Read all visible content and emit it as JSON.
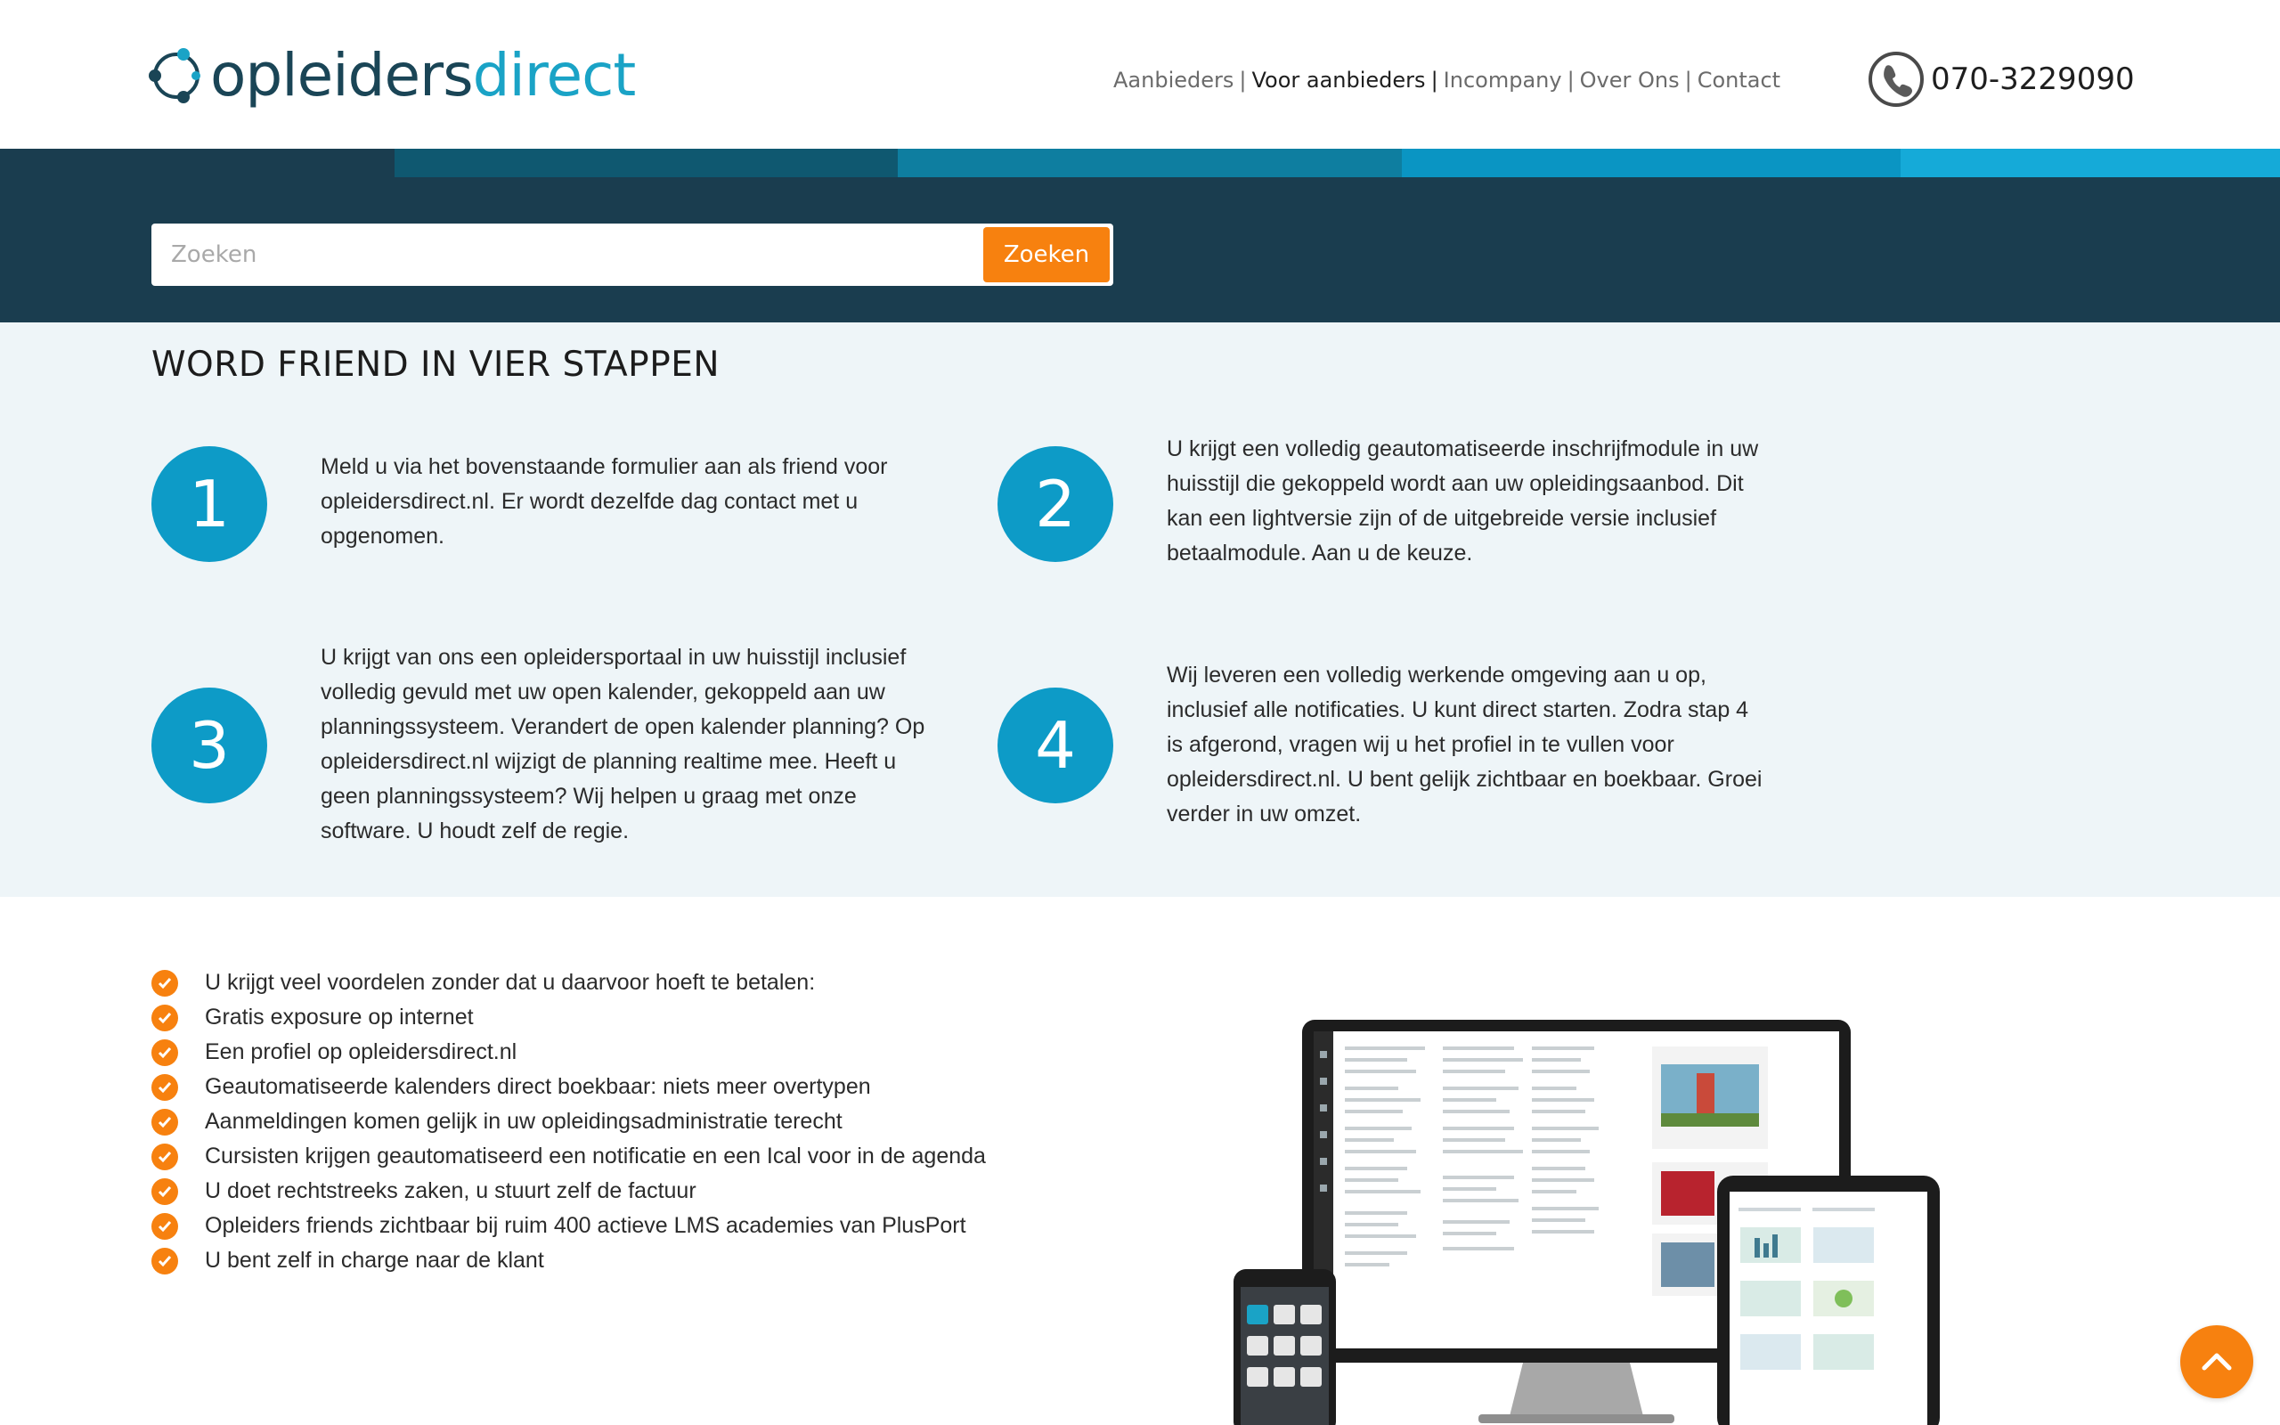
{
  "header": {
    "logo": {
      "part1": "opleiders",
      "part2": "direct"
    },
    "nav": [
      {
        "label": "Aanbieders",
        "active": false
      },
      {
        "label": "Voor aanbieders",
        "active": true
      },
      {
        "label": "Incompany",
        "active": false
      },
      {
        "label": "Over Ons",
        "active": false
      },
      {
        "label": "Contact",
        "active": false
      }
    ],
    "phone": "070-3229090"
  },
  "search": {
    "placeholder": "Zoeken",
    "button_label": "Zoeken"
  },
  "steps": {
    "title": "WORD FRIEND IN VIER STAPPEN",
    "items": [
      {
        "number": "1",
        "lines": [
          "Meld u via het bovenstaande formulier aan als friend voor",
          "opleidersdirect.nl. Er wordt dezelfde dag contact met u",
          "opgenomen."
        ]
      },
      {
        "number": "2",
        "lines": [
          "U krijgt een volledig geautomatiseerde inschrijfmodule in uw",
          "huisstijl die gekoppeld wordt aan uw opleidingsaanbod. Dit",
          "kan een lightversie zijn of de uitgebreide versie inclusief",
          "betaalmodule. Aan u de keuze."
        ]
      },
      {
        "number": "3",
        "lines": [
          "U krijgt van ons een opleidersportaal in uw huisstijl inclusief",
          "volledig gevuld met uw open kalender, gekoppeld aan uw",
          "planningssysteem. Verandert de open kalender planning? Op",
          "opleidersdirect.nl wijzigt de planning realtime mee. Heeft u",
          "geen planningssysteem? Wij helpen u graag met onze",
          "software. U houdt zelf de regie."
        ]
      },
      {
        "number": "4",
        "lines": [
          "Wij leveren een volledig werkende omgeving aan u op,",
          "inclusief alle notificaties. U kunt direct starten. Zodra stap 4",
          "is afgerond, vragen wij u het profiel in te vullen voor",
          "opleidersdirect.nl. U bent gelijk zichtbaar en boekbaar. Groei",
          "verder in uw omzet."
        ]
      }
    ]
  },
  "benefits": [
    "U krijgt veel voordelen zonder dat u daarvoor hoeft te betalen:",
    "Gratis exposure op internet",
    "Een profiel op opleidersdirect.nl",
    "Geautomatiseerde kalenders direct boekbaar: niets meer overtypen",
    "Aanmeldingen komen gelijk in uw opleidingsadministratie terecht",
    "Cursisten krijgen geautomatiseerd een notificatie en een Ical voor in de agenda",
    "U doet rechtstreeks zaken, u stuurt zelf de factuur",
    "Opleiders friends zichtbaar bij ruim 400 actieve LMS academies van PlusPort",
    "U bent zelf in charge naar de klant"
  ],
  "colors": {
    "brand_dark": "#1a3d4f",
    "brand_blue": "#0d9bc7",
    "accent_orange": "#f7810f",
    "steps_bg": "#eef5f8"
  },
  "icons": {
    "phone": "phone-icon",
    "check": "check-icon",
    "to_top": "chevron-up-icon"
  }
}
